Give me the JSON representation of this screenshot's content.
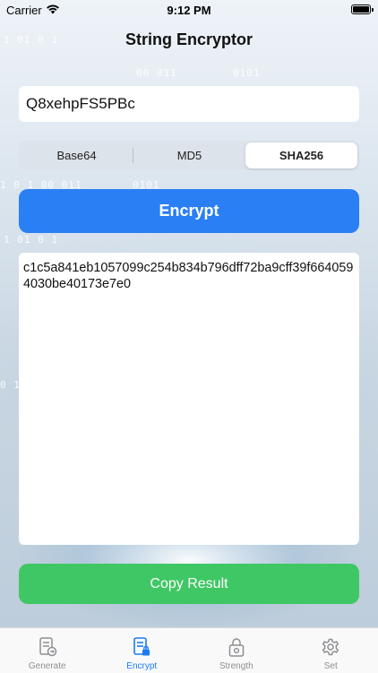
{
  "status_bar": {
    "carrier": "Carrier",
    "time": "9:12 PM"
  },
  "header": {
    "title": "String Encryptor"
  },
  "input": {
    "value": "Q8xehpFS5PBc"
  },
  "segmented": {
    "options": [
      "Base64",
      "MD5",
      "SHA256"
    ],
    "selected": "SHA256"
  },
  "encrypt_button": {
    "label": "Encrypt"
  },
  "result": {
    "text": "c1c5a841eb1057099c254b834b796dff72ba9cff39f6640594030be40173e7e0"
  },
  "copy_button": {
    "label": "Copy Result"
  },
  "tab_bar": {
    "tabs": [
      {
        "label": "Generate",
        "icon": "generate-icon"
      },
      {
        "label": "Encrypt",
        "icon": "encrypt-icon"
      },
      {
        "label": "Strength",
        "icon": "lock-icon"
      },
      {
        "label": "Set",
        "icon": "gear-icon"
      }
    ],
    "active": "Encrypt"
  },
  "background_binary": [
    "1  01 0  1",
    "00  011",
    "0101",
    "1  0 1  00  011",
    "0101",
    "1  01 0  1",
    "0 1",
    "1  01 0  1"
  ],
  "colors": {
    "encrypt_button": "#2a7ff5",
    "copy_button": "#40c765",
    "active_tab": "#1a7cf5",
    "inactive_tab": "#8e8e93"
  }
}
